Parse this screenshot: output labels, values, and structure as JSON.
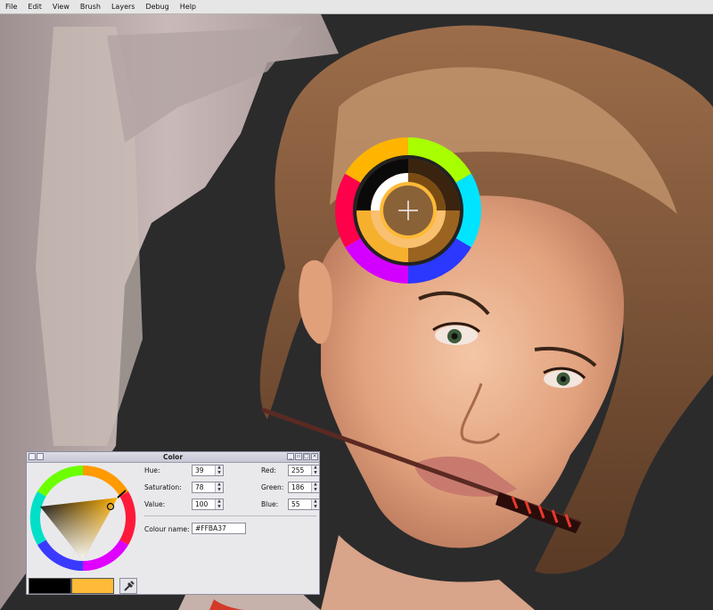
{
  "menubar": {
    "items": [
      "File",
      "Edit",
      "View",
      "Brush",
      "Layers",
      "Debug",
      "Help"
    ]
  },
  "canvas": {
    "description_icon": "painting-canvas"
  },
  "hue_popup": {
    "icon": "crosshair-icon"
  },
  "color_dialog": {
    "title": "Color",
    "hue_label": "Hue:",
    "hue": "39",
    "saturation_label": "Saturation:",
    "saturation": "78",
    "value_label": "Value:",
    "value": "100",
    "red_label": "Red:",
    "red": "255",
    "green_label": "Green:",
    "green": "186",
    "blue_label": "Blue:",
    "blue": "55",
    "colour_name_label": "Colour name:",
    "colour_name": "#FFBA37",
    "previous_color": "#000000",
    "current_color": "#FFBA37"
  }
}
